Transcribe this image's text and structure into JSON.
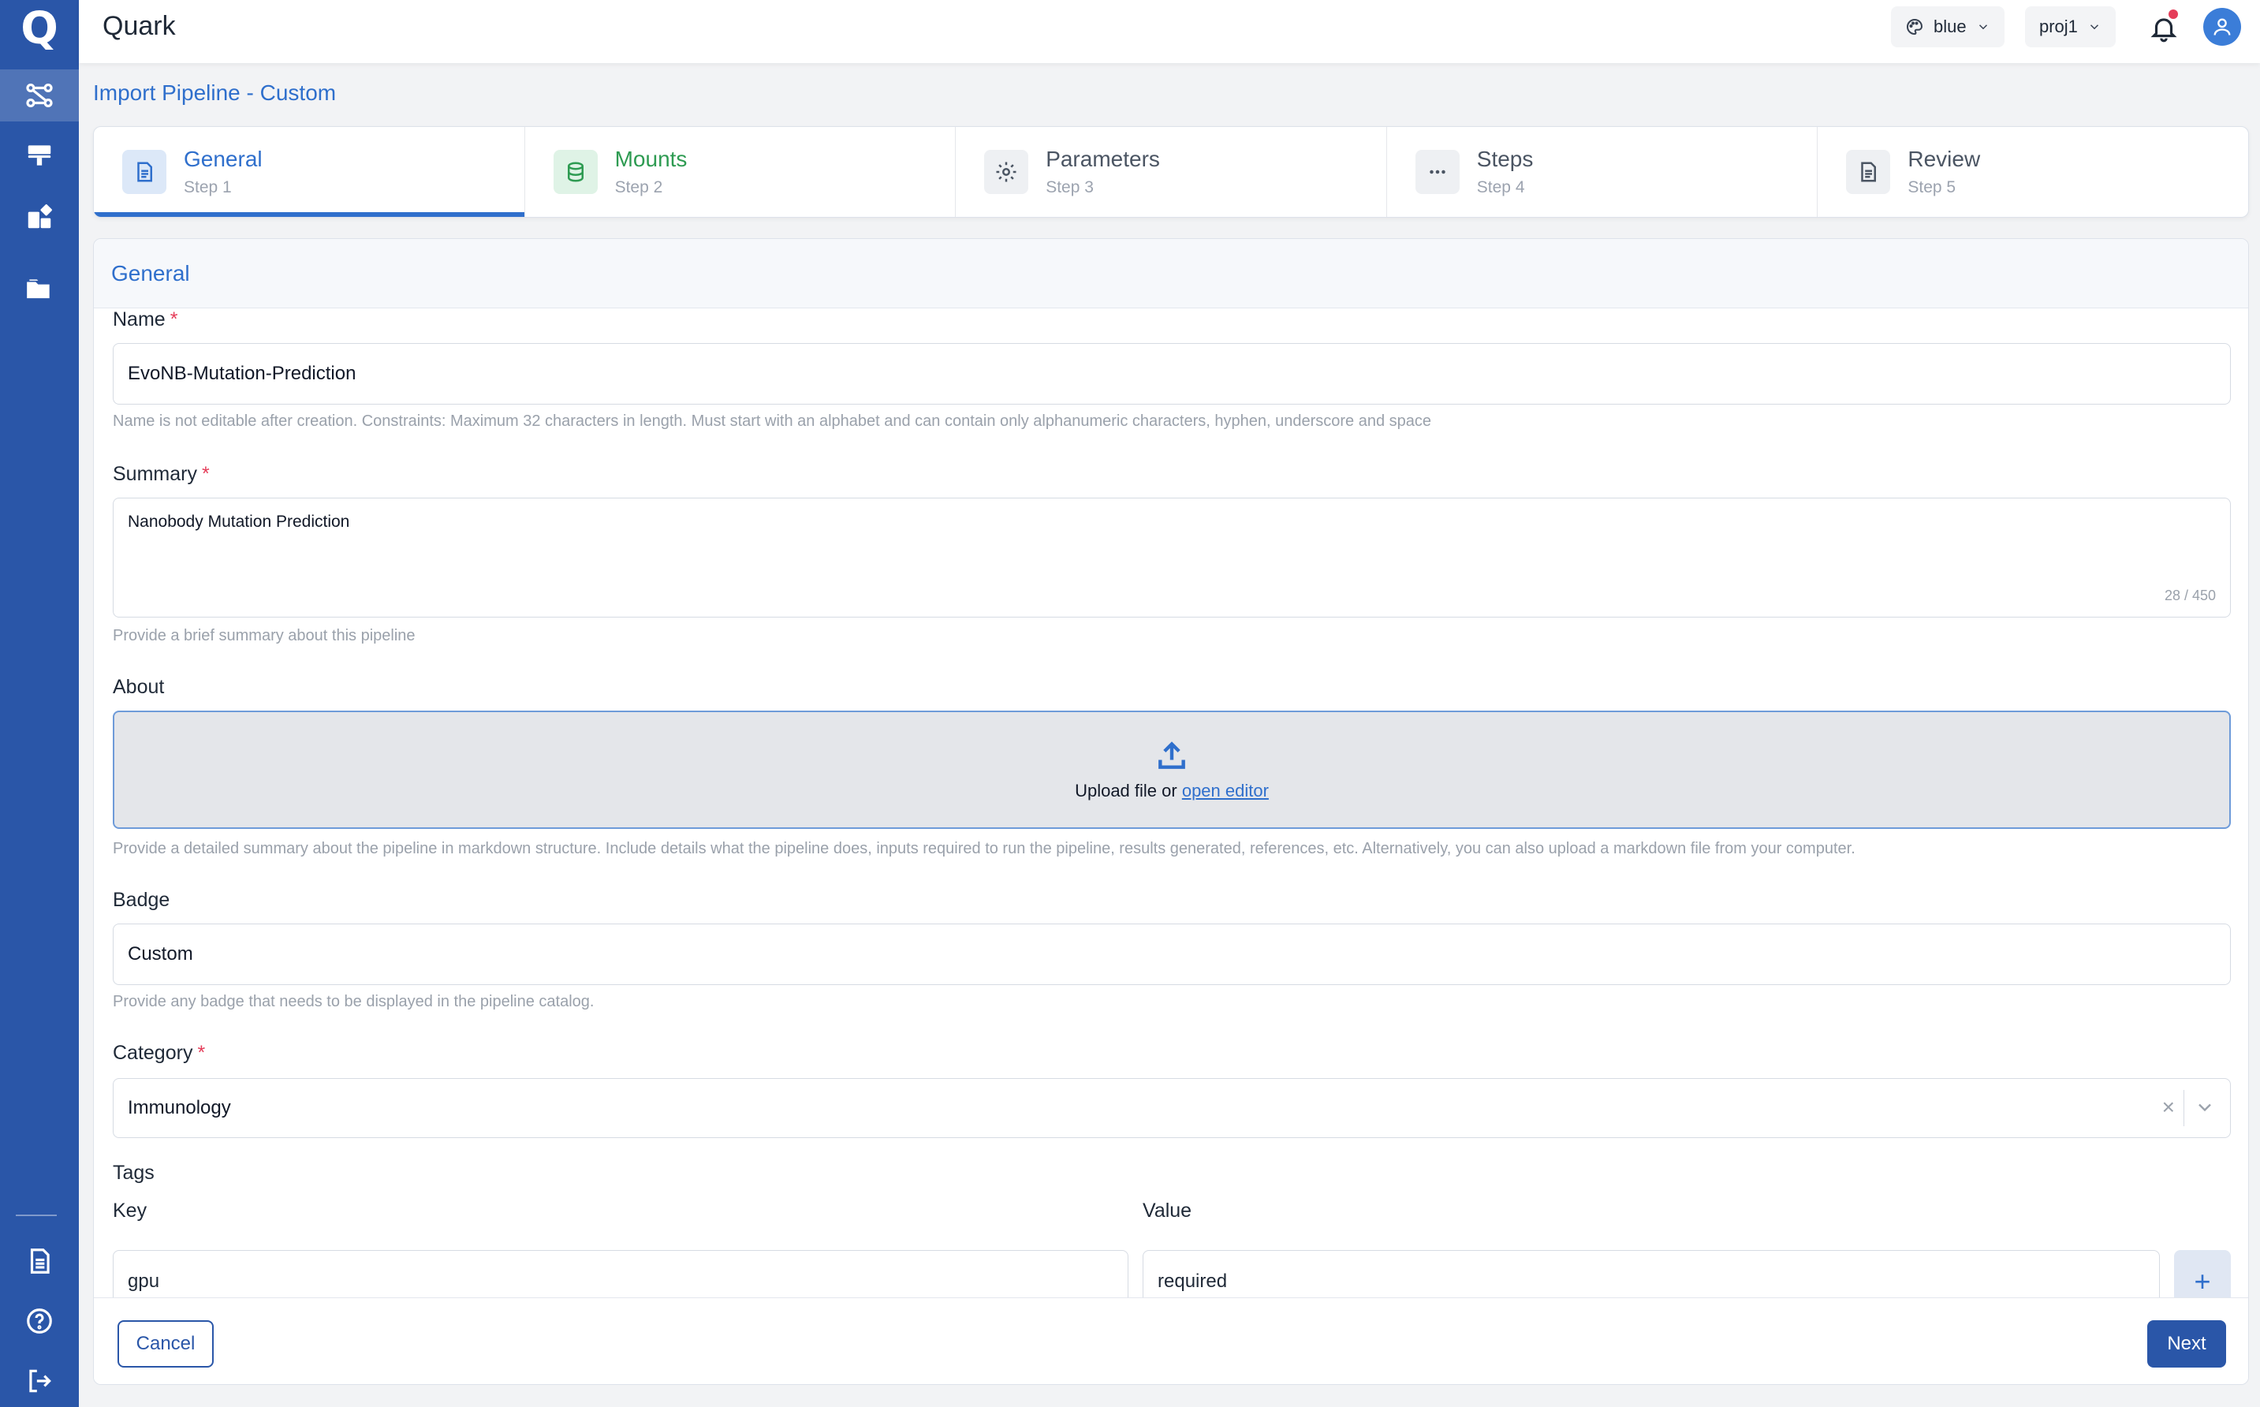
{
  "app": {
    "title": "Quark",
    "logo_letter": "Q"
  },
  "sidebar": {
    "items": [
      {
        "name": "pipelines",
        "icon": "workflow-icon",
        "active": true
      },
      {
        "name": "stations",
        "icon": "server-icon",
        "active": false
      },
      {
        "name": "extensions",
        "icon": "puzzle-icon",
        "active": false
      },
      {
        "name": "files",
        "icon": "folder-icon",
        "active": false
      }
    ],
    "bottom_items": [
      {
        "name": "docs",
        "icon": "document-icon"
      },
      {
        "name": "help",
        "icon": "help-icon"
      },
      {
        "name": "logout",
        "icon": "logout-icon"
      }
    ]
  },
  "topbar": {
    "theme_select": "blue",
    "project_select": "proj1",
    "notification_badge": true
  },
  "page": {
    "title": "Import Pipeline - Custom"
  },
  "stepper": {
    "steps": [
      {
        "title": "General",
        "sub": "Step 1",
        "state": "active",
        "icon": "document-icon"
      },
      {
        "title": "Mounts",
        "sub": "Step 2",
        "state": "done",
        "icon": "database-icon"
      },
      {
        "title": "Parameters",
        "sub": "Step 3",
        "state": "pending",
        "icon": "gear-icon"
      },
      {
        "title": "Steps",
        "sub": "Step 4",
        "state": "pending",
        "icon": "more-icon"
      },
      {
        "title": "Review",
        "sub": "Step 5",
        "state": "pending",
        "icon": "document-icon"
      }
    ]
  },
  "form": {
    "section_title": "General",
    "name": {
      "label": "Name",
      "required_mark": "*",
      "value": "EvoNB-Mutation-Prediction",
      "helper": "Name is not editable after creation. Constraints: Maximum 32 characters in length. Must start with an alphabet and can contain only alphanumeric characters, hyphen, underscore and space"
    },
    "summary": {
      "label": "Summary",
      "required_mark": "*",
      "value": "Nanobody Mutation Prediction",
      "counter": "28 / 450",
      "helper": "Provide a brief summary about this pipeline"
    },
    "about": {
      "label": "About",
      "upload_text": "Upload file or ",
      "upload_link": "open editor",
      "helper": "Provide a detailed summary about the pipeline in markdown structure. Include details what the pipeline does, inputs required to run the pipeline, results generated, references, etc. Alternatively, you can also upload a markdown file from your computer."
    },
    "badge": {
      "label": "Badge",
      "value": "Custom",
      "helper": "Provide any badge that needs to be displayed in the pipeline catalog."
    },
    "category": {
      "label": "Category",
      "required_mark": "*",
      "value": "Immunology",
      "clear_glyph": "×"
    },
    "tags": {
      "label": "Tags",
      "key_label": "Key",
      "value_label": "Value",
      "rows": [
        {
          "key": "gpu",
          "value": "required"
        }
      ],
      "add_glyph": "+"
    }
  },
  "footer": {
    "cancel_label": "Cancel",
    "next_label": "Next"
  },
  "colors": {
    "primary": "#2a56a8",
    "accent": "#2f6fcc",
    "success": "#2e9b52",
    "danger": "#e53e5a"
  }
}
